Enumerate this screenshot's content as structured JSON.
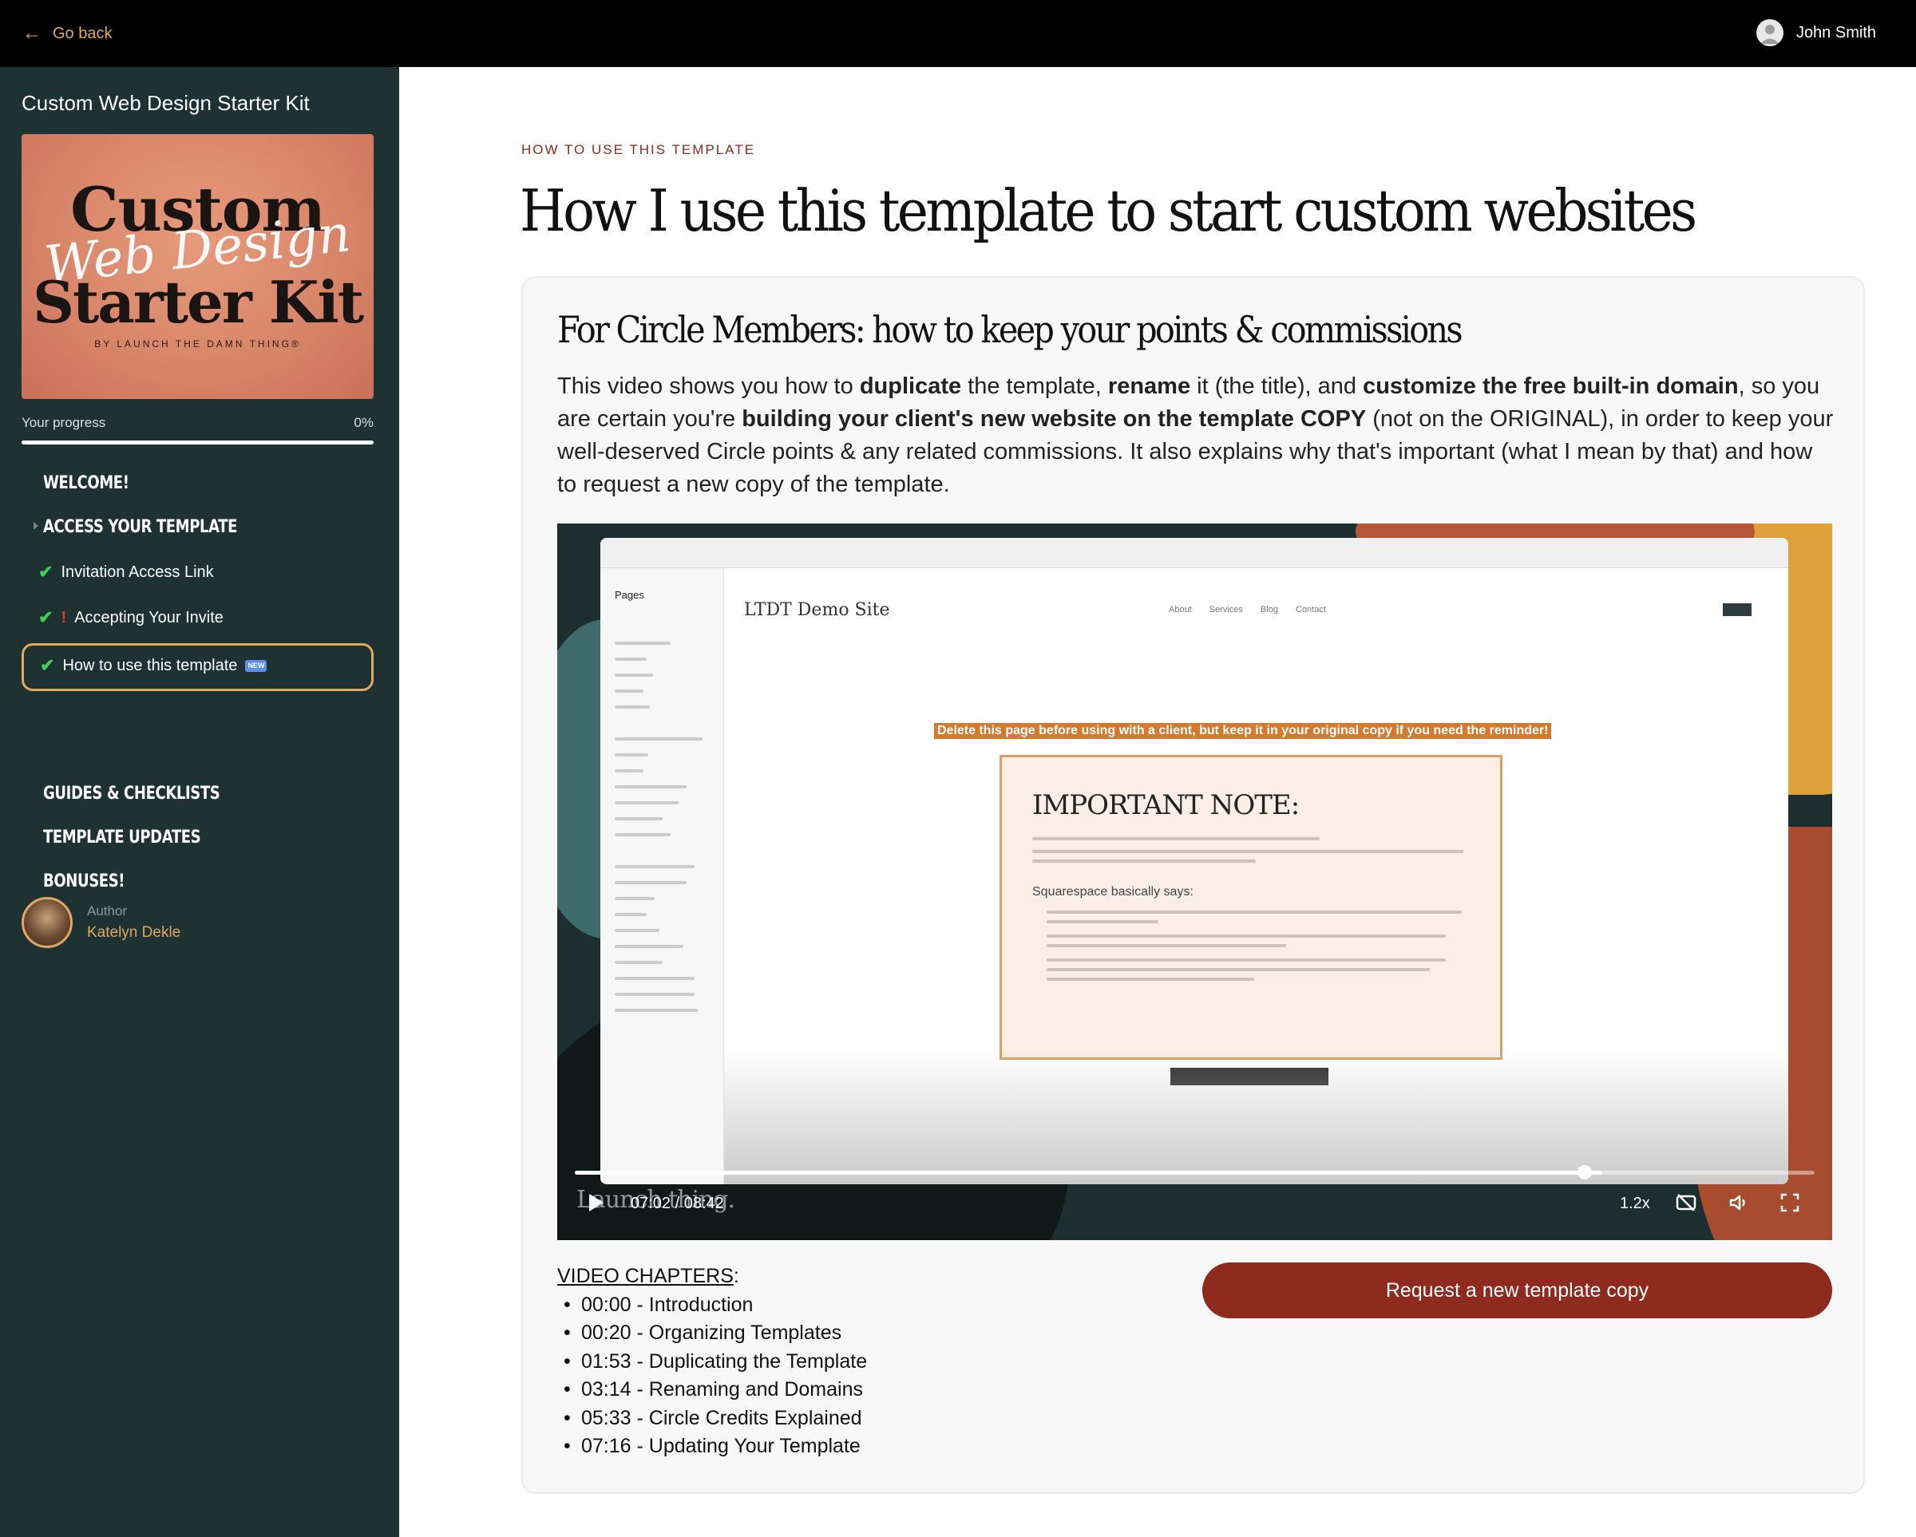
{
  "topbar": {
    "go_back_label": "Go back",
    "user_name": "John Smith"
  },
  "sidebar": {
    "course_title": "Custom Web Design Starter Kit",
    "cover": {
      "line1": "Custom",
      "line2": "Web Design",
      "line3": "Starter Kit",
      "byline": "BY LAUNCH THE DAMN THING®"
    },
    "progress": {
      "label": "Your progress",
      "value_label": "0%",
      "value": 0
    },
    "sections": [
      {
        "label": "WELCOME!"
      },
      {
        "label": "ACCESS YOUR TEMPLATE"
      },
      {
        "label": "GUIDES & CHECKLISTS"
      },
      {
        "label": "TEMPLATE UPDATES"
      },
      {
        "label": "BONUSES!"
      }
    ],
    "lessons": [
      {
        "label": "Invitation Access Link",
        "completed": true
      },
      {
        "label": "Accepting Your Invite",
        "completed": true,
        "flag": "!"
      },
      {
        "label": "How to use this template",
        "completed": true,
        "badge": "NEW",
        "active": true
      }
    ],
    "author": {
      "caption": "Author",
      "name": "Katelyn Dekle"
    }
  },
  "main": {
    "eyebrow": "HOW TO USE THIS TEMPLATE",
    "title": "How I use this template to start custom websites",
    "card": {
      "title": "For Circle Members: how to keep your points & commissions",
      "desc": {
        "t1": "This video shows you how to ",
        "b1": "duplicate",
        "t2": " the template, ",
        "b2": "rename",
        "t3": " it (the title), and ",
        "b3": "customize the free built-in domain",
        "t4": ", so you are certain you're ",
        "b4": "building your client's new website on the template COPY",
        "t5": " (not on the ORIGINAL), in order to keep your well-deserved Circle points & any related commissions. It also explains why that's important (what I mean by that) and how to request a new copy of the template."
      },
      "video": {
        "screen": {
          "pages_label": "Pages",
          "site_name": "LTDT Demo Site",
          "nav": [
            "About",
            "Services",
            "Blog",
            "Contact"
          ],
          "banner": "Delete this page before using with a client, but keep it in your original copy if you need the reminder!",
          "note_title": "IMPORTANT NOTE:",
          "note_says": "Squarespace basically says:"
        },
        "brand": "Launch thing.",
        "current_time": "07:02",
        "duration": "08:42",
        "time_label": "07:02 / 08:42",
        "progress": 0.829,
        "speed": "1.2x",
        "icons": [
          "play-icon",
          "captions-off-icon",
          "volume-icon",
          "fullscreen-icon"
        ]
      },
      "chapters_heading": "VIDEO CHAPTERS",
      "chapters_colon": ":",
      "chapters": [
        "00:00 - Introduction",
        "00:20 - Organizing Templates",
        "01:53 - Duplicating the Template",
        "03:14 - Renaming and Domains",
        "05:33 - Circle Credits Explained",
        "07:16 - Updating Your Template"
      ],
      "request_button": "Request a new template copy"
    }
  },
  "colors": {
    "accent": "#e0a860",
    "sidebar_bg": "#1d3231",
    "button": "#8e2b1e",
    "check": "#3ecf5a",
    "warning": "#e53935"
  }
}
